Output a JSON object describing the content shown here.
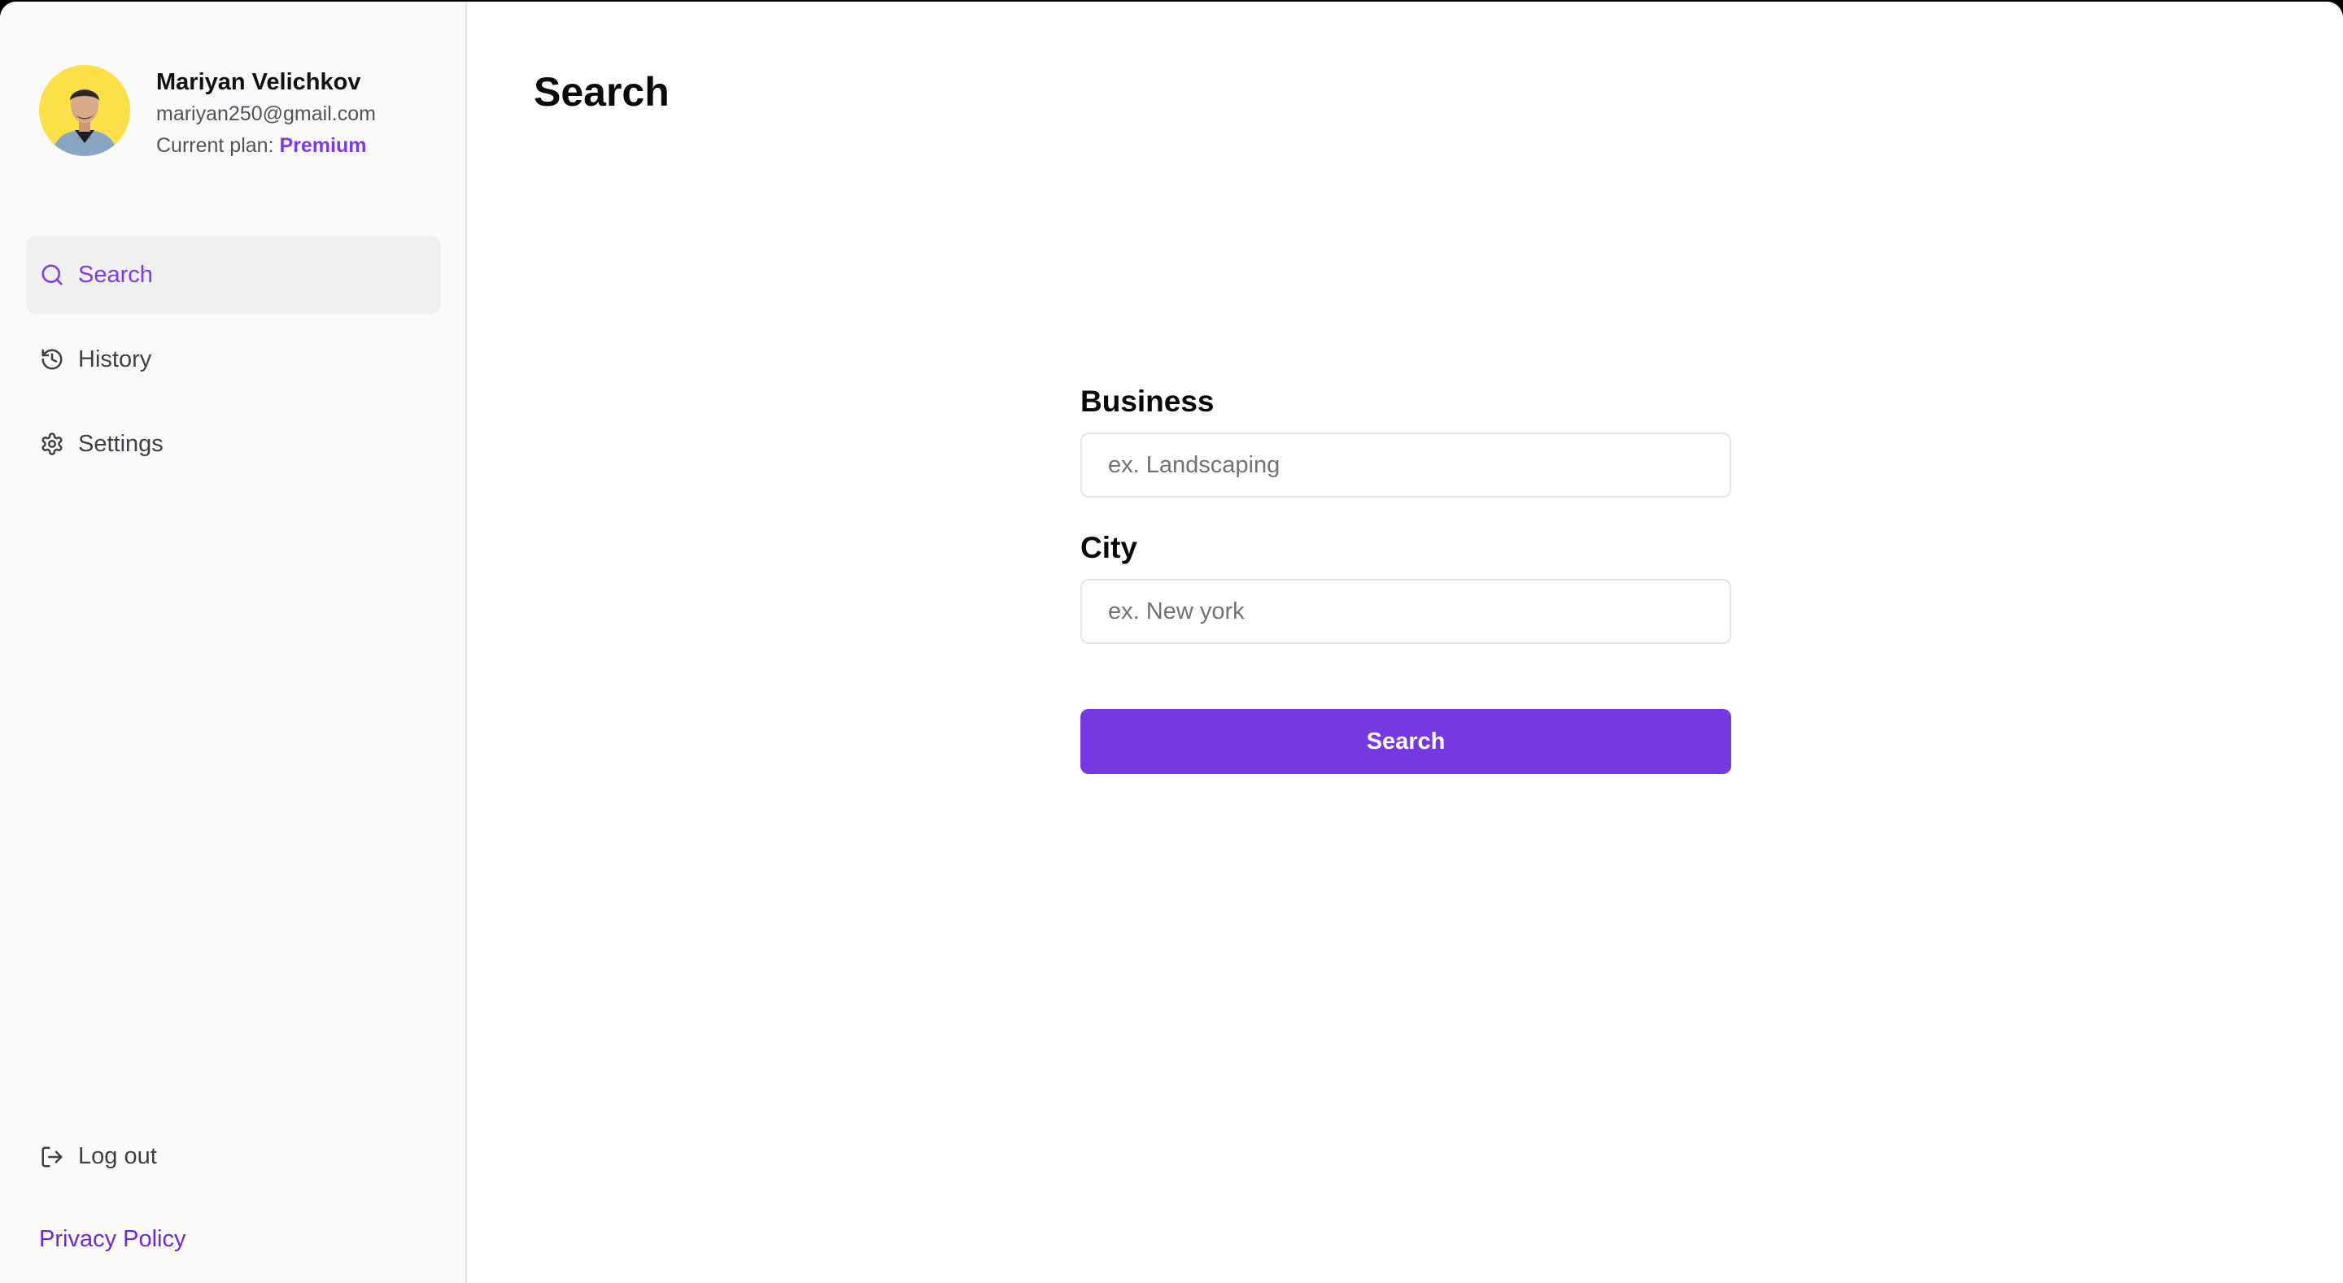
{
  "user": {
    "name": "Mariyan Velichkov",
    "email": "mariyan250@gmail.com",
    "plan_label": "Current plan:",
    "plan_value": "Premium"
  },
  "sidebar": {
    "items": [
      {
        "label": "Search",
        "icon": "search-icon",
        "active": true
      },
      {
        "label": "History",
        "icon": "history-icon",
        "active": false
      },
      {
        "label": "Settings",
        "icon": "gear-icon",
        "active": false
      }
    ],
    "logout_label": "Log out",
    "privacy_label": "Privacy Policy"
  },
  "main": {
    "title": "Search",
    "business": {
      "label": "Business",
      "placeholder": "ex. Landscaping",
      "value": ""
    },
    "city": {
      "label": "City",
      "placeholder": "ex. New york",
      "value": ""
    },
    "submit_label": "Search"
  },
  "colors": {
    "accent": "#7539e3",
    "sidebar_bg": "#fafafa",
    "avatar_bg": "#fde047"
  }
}
